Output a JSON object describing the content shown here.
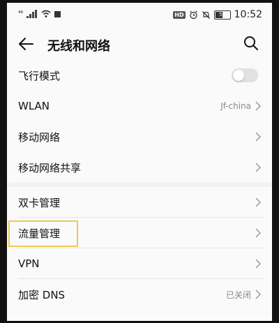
{
  "status_bar": {
    "signal_text": "⁴⁶",
    "time": "10:52",
    "hd_badge": "HD",
    "battery_level": "57",
    "battery_fraction": 0.57,
    "icons": [
      "signal-icon",
      "wifi-icon",
      "notification-icon",
      "hd-icon",
      "alarm-icon",
      "mute-icon",
      "battery-icon"
    ]
  },
  "header": {
    "title": "无线和网络",
    "back_icon": "back-arrow-icon",
    "search_icon": "search-icon"
  },
  "group1": [
    {
      "label": "飞行模式",
      "type": "toggle",
      "on": false
    },
    {
      "label": "WLAN",
      "value": "Jf-china",
      "type": "link"
    },
    {
      "label": "移动网络",
      "type": "link"
    },
    {
      "label": "移动网络共享",
      "type": "link"
    }
  ],
  "group2": [
    {
      "label": "双卡管理",
      "type": "link"
    },
    {
      "label": "流量管理",
      "type": "link",
      "highlighted": true
    },
    {
      "label": "VPN",
      "type": "link"
    },
    {
      "label": "加密 DNS",
      "value": "已关闭",
      "type": "link"
    }
  ],
  "colors": {
    "background": "#f2f2f2",
    "surface": "#fafafa",
    "highlight": "#f2c94c",
    "toggle_off": "#e1e1e1"
  }
}
